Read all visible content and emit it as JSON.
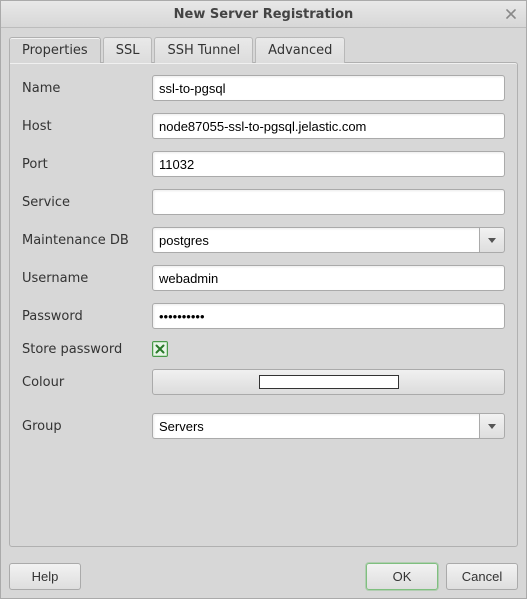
{
  "window": {
    "title": "New Server Registration"
  },
  "tabs": {
    "properties": "Properties",
    "ssl": "SSL",
    "ssh_tunnel": "SSH Tunnel",
    "advanced": "Advanced"
  },
  "fields": {
    "name": {
      "label": "Name",
      "value": "ssl-to-pgsql"
    },
    "host": {
      "label": "Host",
      "value": "node87055-ssl-to-pgsql.jelastic.com"
    },
    "port": {
      "label": "Port",
      "value": "11032"
    },
    "service": {
      "label": "Service",
      "value": ""
    },
    "maintenance_db": {
      "label": "Maintenance DB",
      "value": "postgres"
    },
    "username": {
      "label": "Username",
      "value": "webadmin"
    },
    "password": {
      "label": "Password",
      "value": "••••••••••"
    },
    "store_password": {
      "label": "Store password",
      "checked": true
    },
    "colour": {
      "label": "Colour",
      "swatch": "#ffffff"
    },
    "group": {
      "label": "Group",
      "value": "Servers"
    }
  },
  "buttons": {
    "help": "Help",
    "ok": "OK",
    "cancel": "Cancel"
  }
}
